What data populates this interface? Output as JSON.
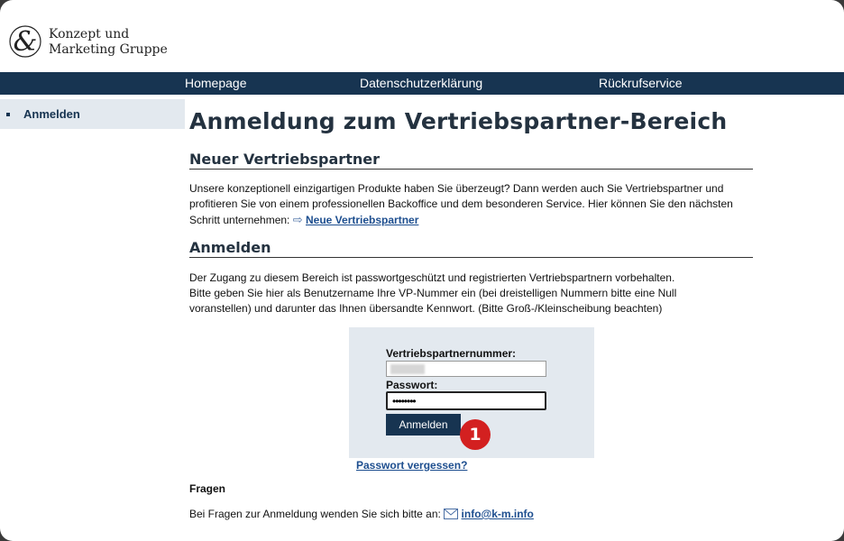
{
  "logo": {
    "line1": "Konzept und",
    "line2": "Marketing Gruppe",
    "symbol": "&"
  },
  "nav": {
    "home": "Homepage",
    "privacy": "Datenschutzerklärung",
    "callback": "Rückrufservice"
  },
  "sidebar": {
    "items": [
      {
        "label": "Anmelden"
      }
    ]
  },
  "main": {
    "title": "Anmeldung zum Vertriebspartner-Bereich",
    "new_partner": {
      "heading": "Neuer Vertriebspartner",
      "text_line1": "Unsere konzeptionell einzigartigen Produkte haben Sie überzeugt? Dann werden auch Sie Vertriebspartner und",
      "text_line2": "profitieren Sie von einem professionellen Backoffice und dem besonderen Service. Hier können Sie den nächsten",
      "text_line3": "Schritt unternehmen:",
      "arrow": "⇨",
      "link": "Neue Vertriebspartner"
    },
    "login": {
      "heading": "Anmelden",
      "text_line1": "Der Zugang zu diesem Bereich ist passwortgeschützt und registrierten Vertriebspartnern vorbehalten.",
      "text_line2": "Bitte geben Sie hier als Benutzername Ihre VP-Nummer ein (bei dreistelligen Nummern bitte eine Null",
      "text_line3": "voranstellen) und darunter das Ihnen übersandte Kennwort. (Bitte Groß-/Kleinscheibung beachten)"
    },
    "form": {
      "user_label": "Vertriebspartnernummer:",
      "pw_label": "Passwort:",
      "pw_value": "••••••••",
      "submit": "Anmelden",
      "badge": "1",
      "forgot": "Passwort vergessen?"
    },
    "questions": {
      "heading": "Fragen",
      "text": "Bei Fragen zur Anmeldung wenden Sie sich bitte an:",
      "email": "info@k-m.info"
    }
  }
}
